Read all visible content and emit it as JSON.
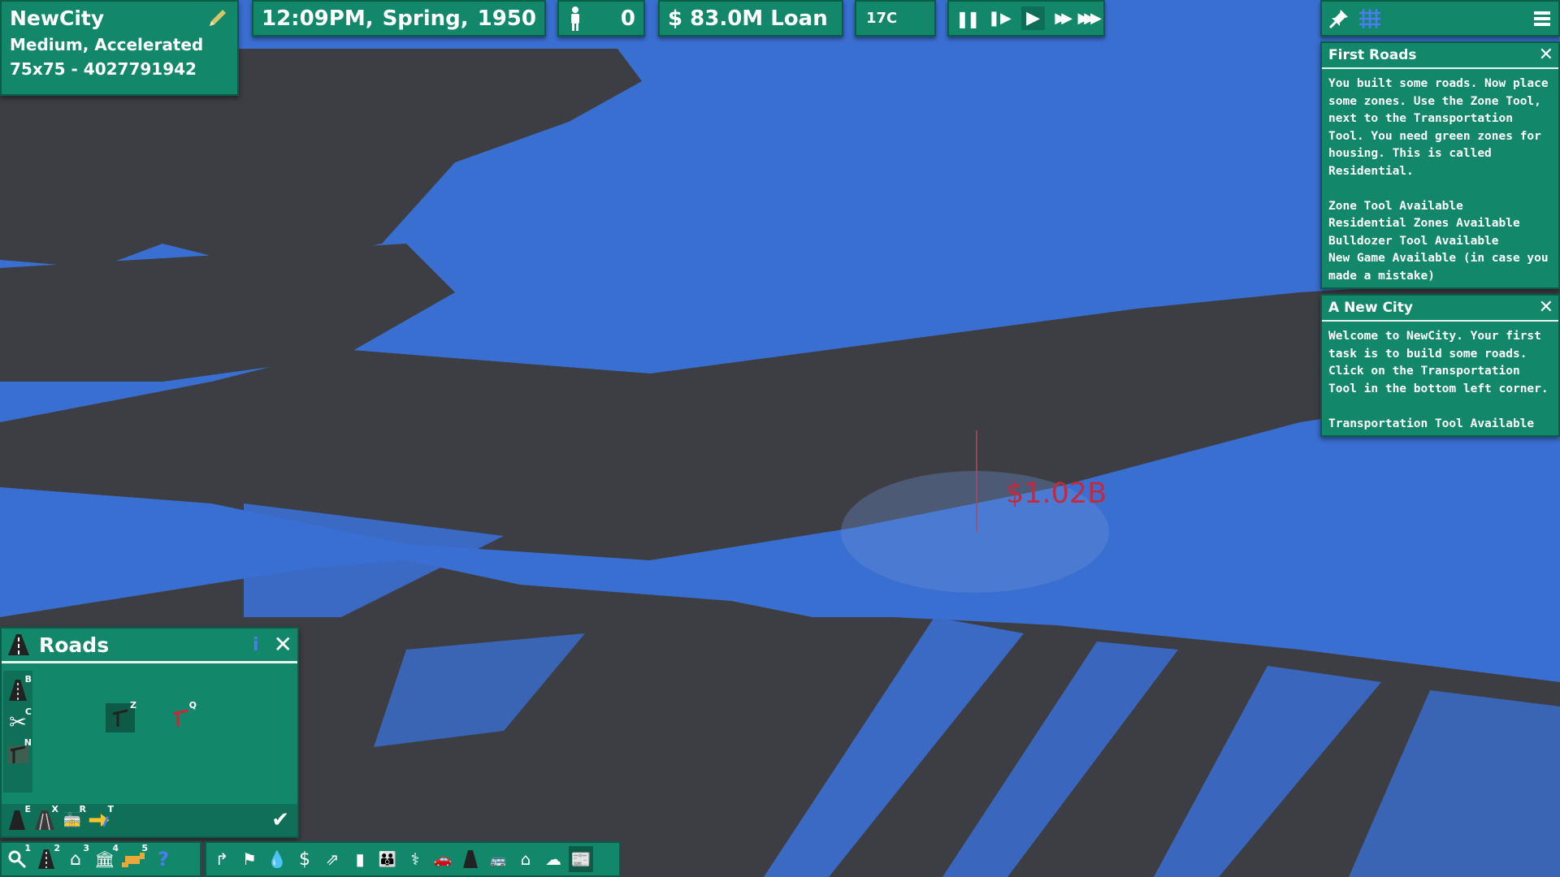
{
  "city": {
    "name": "NewCity",
    "difficulty": "Medium,  Accelerated",
    "size_seed": "75x75  -  4027791942"
  },
  "hud": {
    "time": "12:09PM,",
    "season": "Spring,",
    "year": "1950",
    "population": "0",
    "money": "$  83.0M  Loan",
    "temperature": "17C"
  },
  "speed_controls": [
    "pause-icon",
    "step-icon",
    "play-icon",
    "fast-forward-icon",
    "fastest-icon"
  ],
  "top_right": {
    "icons": [
      "pin-icon",
      "grid-icon",
      "menu-icon"
    ]
  },
  "messages": [
    {
      "title": "First Roads",
      "body": "You built some roads. Now place some zones. Use the Zone Tool, next to the Transportation Tool. You need green zones for housing. This is called Residential.\n\nZone Tool Available\nResidential Zones Available\nBulldozer Tool Available\nNew Game Available (in case you made a mistake)"
    },
    {
      "title": "A  New  City",
      "body": "Welcome to NewCity. Your first task is to build some roads. Click on the Transportation Tool in the bottom left corner.\n\nTransportation Tool Available"
    }
  ],
  "roads_panel": {
    "title": "Roads",
    "side_tools": [
      {
        "icon": "road-icon",
        "key": "B"
      },
      {
        "icon": "scissors-icon",
        "key": "C"
      },
      {
        "icon": "signpost-icon",
        "key": "N"
      }
    ],
    "grid_tools": [
      {
        "icon": "road-type-icon",
        "key": "Z"
      },
      {
        "icon": "red-road-type-icon",
        "key": "Q"
      }
    ],
    "bottom_tools": [
      {
        "icon": "road-icon",
        "key": "E"
      },
      {
        "icon": "expressway-icon",
        "key": "X"
      },
      {
        "icon": "rail-icon",
        "key": "R"
      },
      {
        "icon": "transit-icon",
        "key": "T"
      }
    ]
  },
  "bottom_toolbar_left": [
    {
      "icon": "search-icon",
      "key": "1"
    },
    {
      "icon": "road-icon",
      "key": "2"
    },
    {
      "icon": "house-icon",
      "key": "3"
    },
    {
      "icon": "government-icon",
      "key": "4"
    },
    {
      "icon": "bulldozer-icon",
      "key": "5"
    },
    {
      "icon": "help-icon",
      "key": ""
    }
  ],
  "bottom_toolbar_right": [
    "route-icon",
    "flag-icon",
    "water-icon",
    "budget-icon",
    "growth-icon",
    "tower-icon",
    "people-icon",
    "health-icon",
    "car-icon",
    "road-icon",
    "bus-icon",
    "home-icon",
    "heatmap-icon",
    "newspaper-icon"
  ],
  "map_label": {
    "price": "$1.02B"
  },
  "colors": {
    "panel": "#13876a",
    "panel_border": "#0b5c47",
    "water": "#3a6fd2",
    "land": "#3d3e44",
    "price_text": "#c22b3f"
  }
}
